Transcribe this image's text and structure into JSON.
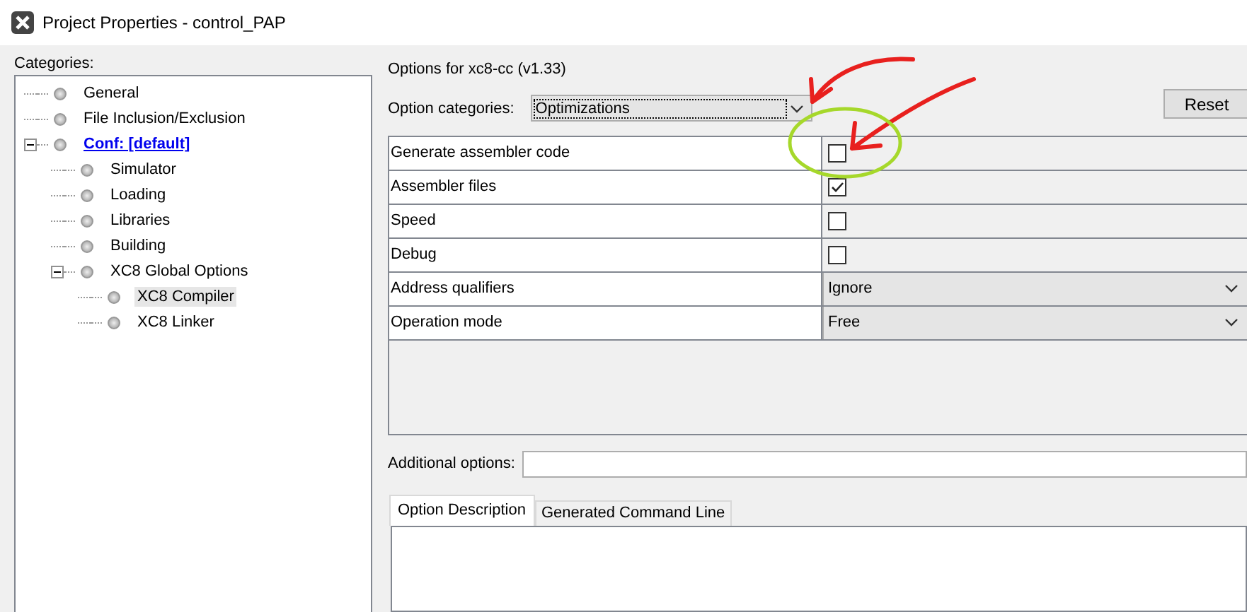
{
  "window": {
    "title": "Project Properties - control_PAP"
  },
  "categories": {
    "label": "Categories:",
    "items": [
      {
        "label": "General",
        "selected": false,
        "link": false
      },
      {
        "label": "File Inclusion/Exclusion",
        "selected": false,
        "link": false
      },
      {
        "label": "Conf: [default]",
        "selected": false,
        "link": true,
        "expanded": true,
        "children": [
          {
            "label": "Simulator",
            "selected": false,
            "link": false
          },
          {
            "label": "Loading",
            "selected": false,
            "link": false
          },
          {
            "label": "Libraries",
            "selected": false,
            "link": false
          },
          {
            "label": "Building",
            "selected": false,
            "link": false
          },
          {
            "label": "XC8 Global Options",
            "selected": false,
            "link": false,
            "expanded": true,
            "children": [
              {
                "label": "XC8 Compiler",
                "selected": true,
                "link": false
              },
              {
                "label": "XC8 Linker",
                "selected": false,
                "link": false
              }
            ]
          }
        ]
      }
    ]
  },
  "options": {
    "heading": "Options for xc8-cc (v1.33)",
    "category_label": "Option categories:",
    "category_value": "Optimizations",
    "reset_button": "Reset",
    "rows": [
      {
        "kind": "checkbox",
        "name": "Generate assembler code",
        "checked": false
      },
      {
        "kind": "checkbox",
        "name": "Assembler files",
        "checked": true
      },
      {
        "kind": "checkbox",
        "name": "Speed",
        "checked": false
      },
      {
        "kind": "checkbox",
        "name": "Debug",
        "checked": false
      },
      {
        "kind": "dropdown",
        "name": "Address qualifiers",
        "value": "Ignore"
      },
      {
        "kind": "dropdown",
        "name": "Operation mode",
        "value": "Free"
      }
    ],
    "additional_label": "Additional options:",
    "tabs": [
      {
        "label": "Option Description",
        "selected": true
      },
      {
        "label": "Generated Command Line",
        "selected": false
      }
    ]
  }
}
